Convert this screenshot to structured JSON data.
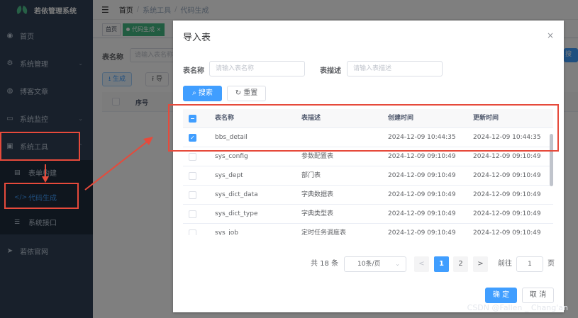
{
  "app": {
    "title": "若依管理系统"
  },
  "sidebar": {
    "items": [
      {
        "label": "首页",
        "icon": "dashboard-icon"
      },
      {
        "label": "系统管理",
        "icon": "gear-icon"
      },
      {
        "label": "博客文章",
        "icon": "globe-icon"
      },
      {
        "label": "系统监控",
        "icon": "monitor-icon"
      },
      {
        "label": "系统工具",
        "icon": "toolbox-icon"
      },
      {
        "label": "表单构建",
        "icon": "form-icon"
      },
      {
        "label": "代码生成",
        "icon": "code-icon"
      },
      {
        "label": "系统接口",
        "icon": "api-icon"
      },
      {
        "label": "若依官网",
        "icon": "send-icon"
      }
    ]
  },
  "breadcrumb": {
    "home": "首页",
    "level1": "系统工具",
    "level2": "代码生成"
  },
  "tags": {
    "home": "首页",
    "active": "代码生成"
  },
  "background": {
    "table_name_label": "表名称",
    "table_name_placeholder": "请输入表名称",
    "search_label": "搜索",
    "generate_label": "生成",
    "import_label": "导",
    "index_header": "序号"
  },
  "dialog": {
    "title": "导入表",
    "close": "×",
    "form": {
      "table_name_label": "表名称",
      "table_name_placeholder": "请输入表名称",
      "table_desc_label": "表描述",
      "table_desc_placeholder": "请输入表描述",
      "search_label": "搜索",
      "reset_label": "重置"
    },
    "table": {
      "headers": [
        "表名称",
        "表描述",
        "创建时间",
        "更新时间"
      ],
      "rows": [
        {
          "name": "bbs_detail",
          "desc": "",
          "created": "2024-12-09 10:44:35",
          "updated": "2024-12-09 10:44:35",
          "checked": true
        },
        {
          "name": "sys_config",
          "desc": "参数配置表",
          "created": "2024-12-09 09:10:49",
          "updated": "2024-12-09 09:10:49",
          "checked": false
        },
        {
          "name": "sys_dept",
          "desc": "部门表",
          "created": "2024-12-09 09:10:49",
          "updated": "2024-12-09 09:10:49",
          "checked": false
        },
        {
          "name": "sys_dict_data",
          "desc": "字典数据表",
          "created": "2024-12-09 09:10:49",
          "updated": "2024-12-09 09:10:49",
          "checked": false
        },
        {
          "name": "sys_dict_type",
          "desc": "字典类型表",
          "created": "2024-12-09 09:10:49",
          "updated": "2024-12-09 09:10:49",
          "checked": false
        },
        {
          "name": "sys_job",
          "desc": "定时任务调度表",
          "created": "2024-12-09 09:10:49",
          "updated": "2024-12-09 09:10:49",
          "checked": false
        }
      ]
    },
    "pagination": {
      "total": "共 18 条",
      "page_size": "10条/页",
      "pages": [
        "1",
        "2"
      ],
      "prev": "<",
      "next": ">",
      "goto_label": "前往",
      "goto_value": "1",
      "page_unit": "页"
    },
    "confirm_label": "确 定",
    "cancel_label": "取 消"
  },
  "watermark": "CSDN @Fallen _ Chang'an",
  "colors": {
    "primary": "#409eff",
    "sidebar_bg": "#304156",
    "highlight": "#e64a3b"
  }
}
